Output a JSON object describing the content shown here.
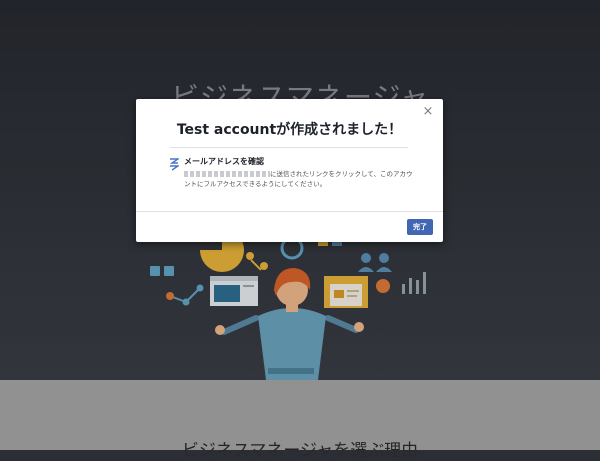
{
  "page": {
    "hero_title": "ビジネスマネージャ",
    "section_title": "ビジネスマネージャを選ぶ理由"
  },
  "modal": {
    "title": "Test accountが作成されました！",
    "close_symbol": "×",
    "confirm_heading": "メールアドレスを確認",
    "confirm_text": "に送信されたリンクをクリックして、このアカウントにフルアクセスできるようにしてください。",
    "done_label": "完了"
  },
  "icons": {
    "close": "close-icon",
    "mail": "mail-icon"
  },
  "colors": {
    "primary_button": "#4267b2",
    "hero_background": "#2b2e35",
    "lower_background": "#a6a6a6"
  }
}
